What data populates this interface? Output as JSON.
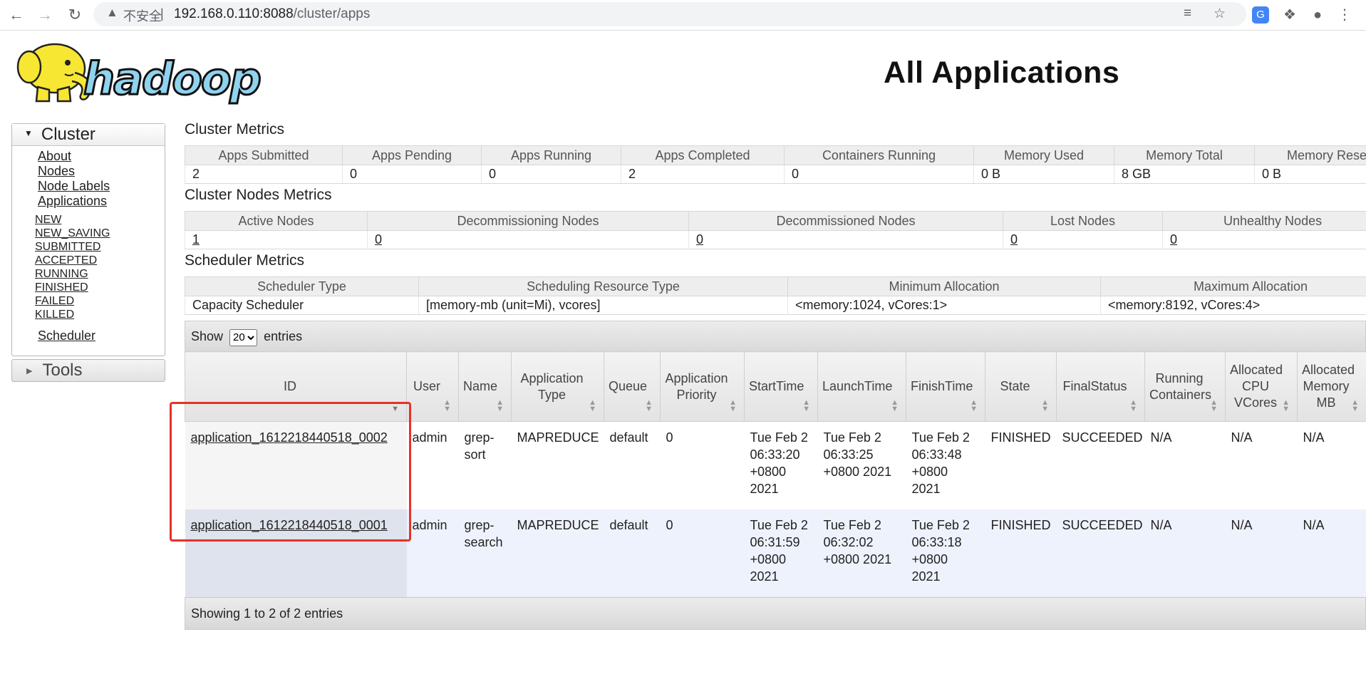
{
  "browser": {
    "security_label": "不安全",
    "url_host": "192.168.0.110:8088",
    "url_path": "/cluster/apps"
  },
  "page": {
    "title": "All Applications",
    "logo_text": "hadoop"
  },
  "nav": {
    "cluster_label": "Cluster",
    "cluster_links": [
      "About",
      "Nodes",
      "Node Labels",
      "Applications"
    ],
    "app_states": [
      "NEW",
      "NEW_SAVING",
      "SUBMITTED",
      "ACCEPTED",
      "RUNNING",
      "FINISHED",
      "FAILED",
      "KILLED"
    ],
    "scheduler_label": "Scheduler",
    "tools_label": "Tools"
  },
  "cluster_metrics": {
    "title": "Cluster Metrics",
    "headers": [
      "Apps Submitted",
      "Apps Pending",
      "Apps Running",
      "Apps Completed",
      "Containers Running",
      "Memory Used",
      "Memory Total",
      "Memory Rese"
    ],
    "values": [
      "2",
      "0",
      "0",
      "2",
      "0",
      "0 B",
      "8 GB",
      "0 B"
    ]
  },
  "node_metrics": {
    "title": "Cluster Nodes Metrics",
    "headers": [
      "Active Nodes",
      "Decommissioning Nodes",
      "Decommissioned Nodes",
      "Lost Nodes",
      "Unhealthy Nodes"
    ],
    "values": [
      "1",
      "0",
      "0",
      "0",
      "0"
    ]
  },
  "scheduler_metrics": {
    "title": "Scheduler Metrics",
    "headers": [
      "Scheduler Type",
      "Scheduling Resource Type",
      "Minimum Allocation",
      "Maximum Allocation"
    ],
    "values": [
      "Capacity Scheduler",
      "[memory-mb (unit=Mi), vcores]",
      "<memory:1024, vCores:1>",
      "<memory:8192, vCores:4>"
    ]
  },
  "apps_table": {
    "show_label": "Show",
    "entries_label": "entries",
    "page_size": "20",
    "headers": [
      "ID",
      "User",
      "Name",
      "Application Type",
      "Queue",
      "Application Priority",
      "StartTime",
      "LaunchTime",
      "FinishTime",
      "State",
      "FinalStatus",
      "Running Containers",
      "Allocated CPU VCores",
      "Allocated Memory MB"
    ],
    "rows": [
      [
        "application_1612218440518_0002",
        "admin",
        "grep-sort",
        "MAPREDUCE",
        "default",
        "0",
        "Tue Feb 2 06:33:20 +0800 2021",
        "Tue Feb 2 06:33:25 +0800 2021",
        "Tue Feb 2 06:33:48 +0800 2021",
        "FINISHED",
        "SUCCEEDED",
        "N/A",
        "N/A",
        "N/A"
      ],
      [
        "application_1612218440518_0001",
        "admin",
        "grep-search",
        "MAPREDUCE",
        "default",
        "0",
        "Tue Feb 2 06:31:59 +0800 2021",
        "Tue Feb 2 06:32:02 +0800 2021",
        "Tue Feb 2 06:33:18 +0800 2021",
        "FINISHED",
        "SUCCEEDED",
        "N/A",
        "N/A",
        "N/A"
      ]
    ],
    "footer": "Showing 1 to 2 of 2 entries"
  },
  "colors": {
    "highlight_box": "#e6312a",
    "even_row": "#eef2fd"
  }
}
